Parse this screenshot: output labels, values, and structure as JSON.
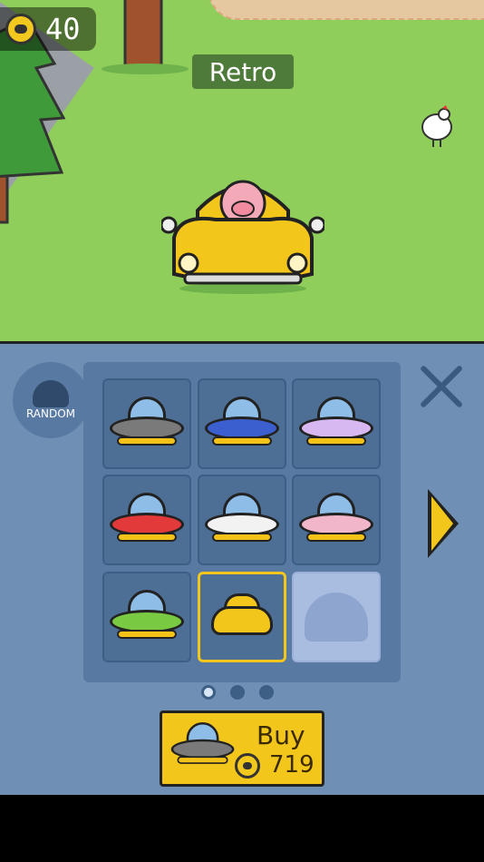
{
  "hud": {
    "coins": "40"
  },
  "vehicle_name": "Retro",
  "shop": {
    "random_label": "RANDOM",
    "grid": [
      {
        "name": "gray-ufo",
        "color": "#7a7a7a"
      },
      {
        "name": "blue-ufo",
        "color": "#3b5fce"
      },
      {
        "name": "striped-purple-ufo",
        "color": "#d7b8f0"
      },
      {
        "name": "red-ufo",
        "color": "#e23a3a"
      },
      {
        "name": "white-ufo",
        "color": "#f2f2f2"
      },
      {
        "name": "donut-ufo",
        "color": "#f1b6c9"
      },
      {
        "name": "green-ufo",
        "color": "#7ac943"
      },
      {
        "name": "retro-car",
        "color": "#f3c61b"
      },
      {
        "name": "locked",
        "color": "#a9bde0"
      }
    ],
    "selected_index": 7,
    "pages": 3,
    "active_page": 0,
    "buy": {
      "label": "Buy",
      "price": "719"
    }
  },
  "colors": {
    "accent": "#f3c61b",
    "panel": "#6f8fb5",
    "grass": "#8fce5a"
  }
}
